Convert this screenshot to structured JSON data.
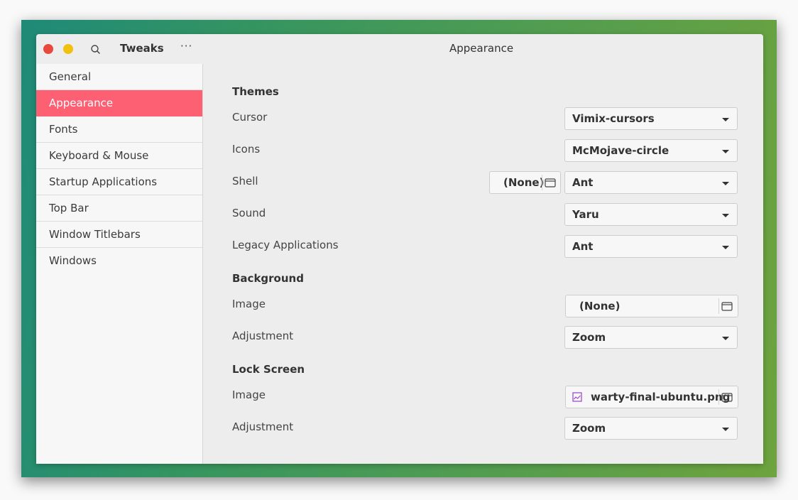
{
  "window": {
    "app_title": "Tweaks",
    "page_title": "Appearance",
    "controls": {
      "close": "close-button",
      "minimize": "minimize-button"
    },
    "search_icon": "search-icon",
    "menu_label": "···"
  },
  "colors": {
    "accent": "#fd5f73",
    "close": "#e9483d",
    "minimize": "#f1c10f",
    "image_icon": "#9a3fc5"
  },
  "sidebar": {
    "items": [
      {
        "label": "General",
        "active": false
      },
      {
        "label": "Appearance",
        "active": true
      },
      {
        "label": "Fonts",
        "active": false
      },
      {
        "label": "Keyboard & Mouse",
        "active": false
      },
      {
        "label": "Startup Applications",
        "active": false
      },
      {
        "label": "Top Bar",
        "active": false
      },
      {
        "label": "Window Titlebars",
        "active": false
      },
      {
        "label": "Windows",
        "active": false
      }
    ]
  },
  "themes": {
    "title": "Themes",
    "cursor": {
      "label": "Cursor",
      "value": "Vimix-cursors"
    },
    "icons": {
      "label": "Icons",
      "value": "McMojave-circle"
    },
    "shell": {
      "label": "Shell",
      "file": "(None)",
      "value": "Ant"
    },
    "sound": {
      "label": "Sound",
      "value": "Yaru"
    },
    "legacy": {
      "label": "Legacy Applications",
      "value": "Ant"
    }
  },
  "background": {
    "title": "Background",
    "image": {
      "label": "Image",
      "file": "(None)"
    },
    "adjustment": {
      "label": "Adjustment",
      "value": "Zoom"
    }
  },
  "lock_screen": {
    "title": "Lock Screen",
    "image": {
      "label": "Image",
      "file": "warty-final-ubuntu.png"
    },
    "adjustment": {
      "label": "Adjustment",
      "value": "Zoom"
    }
  }
}
